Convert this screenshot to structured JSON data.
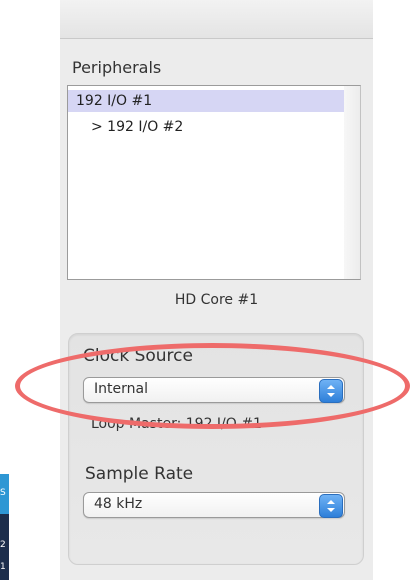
{
  "peripherals": {
    "title": "Peripherals",
    "items": [
      {
        "label": "192 I/O #1",
        "selected": true
      },
      {
        "label": "> 192 I/O #2",
        "selected": false
      }
    ]
  },
  "core": {
    "label": "HD Core #1"
  },
  "clock_source": {
    "label": "Clock Source",
    "selected_value": "Internal",
    "loop_master": "Loop Master: 192 I/O #1"
  },
  "sample_rate": {
    "label": "Sample Rate",
    "selected_value": "48 kHz"
  },
  "edge_badge": {
    "top_text": "S",
    "bottom_text": "2",
    "bottom_text2": "1"
  },
  "colors": {
    "highlight_oval": "#ee6b6a",
    "selection": "#d6d6f4",
    "stepper": "#2d7fd9"
  }
}
